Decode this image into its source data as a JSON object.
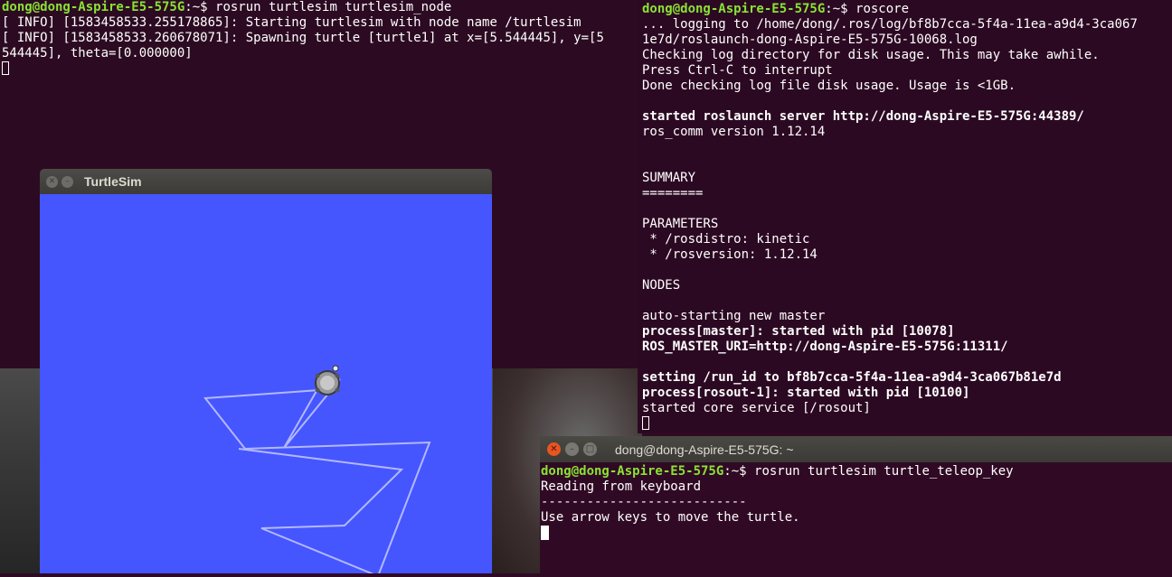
{
  "left_terminal": {
    "prompt_user": "dong@dong-Aspire-E5-575G",
    "prompt_path": ":~$ ",
    "command": "rosrun turtlesim turtlesim_node",
    "lines": [
      "[ INFO] [1583458533.255178865]: Starting turtlesim with node name /turtlesim",
      "[ INFO] [1583458533.260678071]: Spawning turtle [turtle1] at x=[5.544445], y=[5",
      "544445], theta=[0.000000]"
    ]
  },
  "right_terminal": {
    "prompt_user": "dong@dong-Aspire-E5-575G",
    "prompt_path": ":~$ ",
    "command": "roscore",
    "lines": [
      {
        "text": "... logging to /home/dong/.ros/log/bf8b7cca-5f4a-11ea-a9d4-3ca067",
        "bold": false
      },
      {
        "text": "1e7d/roslaunch-dong-Aspire-E5-575G-10068.log",
        "bold": false
      },
      {
        "text": "Checking log directory for disk usage. This may take awhile.",
        "bold": false
      },
      {
        "text": "Press Ctrl-C to interrupt",
        "bold": false
      },
      {
        "text": "Done checking log file disk usage. Usage is <1GB.",
        "bold": false
      },
      {
        "text": "",
        "bold": false
      },
      {
        "text": "started roslaunch server http://dong-Aspire-E5-575G:44389/",
        "bold": true
      },
      {
        "text": "ros_comm version 1.12.14",
        "bold": false
      },
      {
        "text": "",
        "bold": false
      },
      {
        "text": "",
        "bold": false
      },
      {
        "text": "SUMMARY",
        "bold": false
      },
      {
        "text": "========",
        "bold": false
      },
      {
        "text": "",
        "bold": false
      },
      {
        "text": "PARAMETERS",
        "bold": false
      },
      {
        "text": " * /rosdistro: kinetic",
        "bold": false
      },
      {
        "text": " * /rosversion: 1.12.14",
        "bold": false
      },
      {
        "text": "",
        "bold": false
      },
      {
        "text": "NODES",
        "bold": false
      },
      {
        "text": "",
        "bold": false
      },
      {
        "text": "auto-starting new master",
        "bold": false
      },
      {
        "text": "process[master]: started with pid [10078]",
        "bold": true
      },
      {
        "text": "ROS_MASTER_URI=http://dong-Aspire-E5-575G:11311/",
        "bold": true
      },
      {
        "text": "",
        "bold": false
      },
      {
        "text": "setting /run_id to bf8b7cca-5f4a-11ea-a9d4-3ca067b81e7d",
        "bold": true
      },
      {
        "text": "process[rosout-1]: started with pid [10100]",
        "bold": true
      },
      {
        "text": "started core service [/rosout]",
        "bold": false
      }
    ]
  },
  "turtlesim_window": {
    "title": "TurtleSim",
    "background_color": "#4556ff",
    "pen_color": "#b3b8ff"
  },
  "teleop_terminal": {
    "title": "dong@dong-Aspire-E5-575G: ~",
    "prompt_user": "dong@dong-Aspire-E5-575G",
    "prompt_path": ":~$ ",
    "command": "rosrun turtlesim turtle_teleop_key",
    "lines": [
      "Reading from keyboard",
      "---------------------------",
      "Use arrow keys to move the turtle."
    ]
  },
  "icons": {
    "close": "close-icon",
    "minimize": "minimize-icon",
    "maximize": "maximize-icon"
  }
}
